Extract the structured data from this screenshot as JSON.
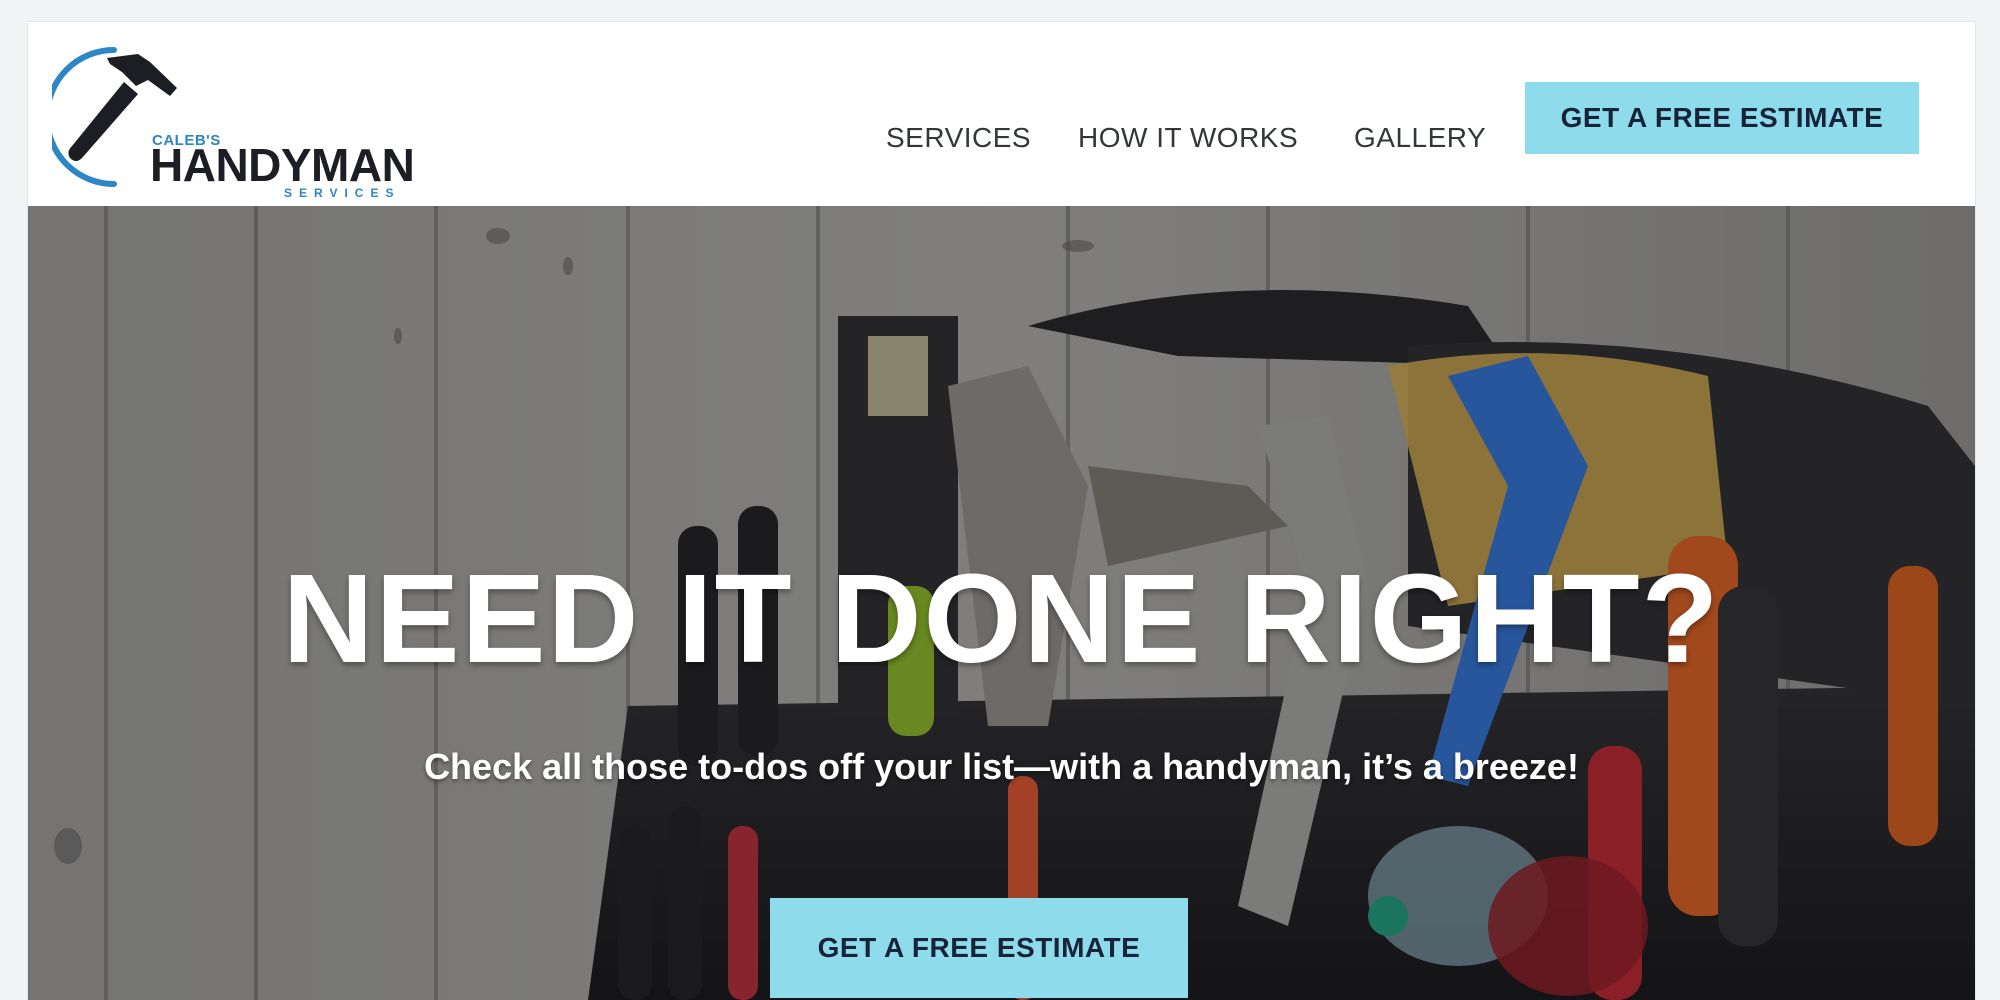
{
  "header": {
    "logo": {
      "small_text": "CALEB'S",
      "main_text": "HANDYMAN",
      "sub_text": "SERVICES"
    },
    "nav": [
      {
        "label": "SERVICES"
      },
      {
        "label": "HOW IT WORKS"
      },
      {
        "label": "GALLERY"
      }
    ],
    "cta_label": "GET A FREE ESTIMATE"
  },
  "hero": {
    "title": "NEED IT DONE RIGHT?",
    "subtitle": "Check all those to-dos off your list—with a handyman, it’s a breeze!",
    "cta_label": "GET A FREE ESTIMATE",
    "background_icon": "tool-bag-photo"
  },
  "colors": {
    "accent": "#8edbec",
    "brand_blue": "#2d86c6",
    "brand_dark": "#1d1d24",
    "cta_text": "#172338"
  }
}
